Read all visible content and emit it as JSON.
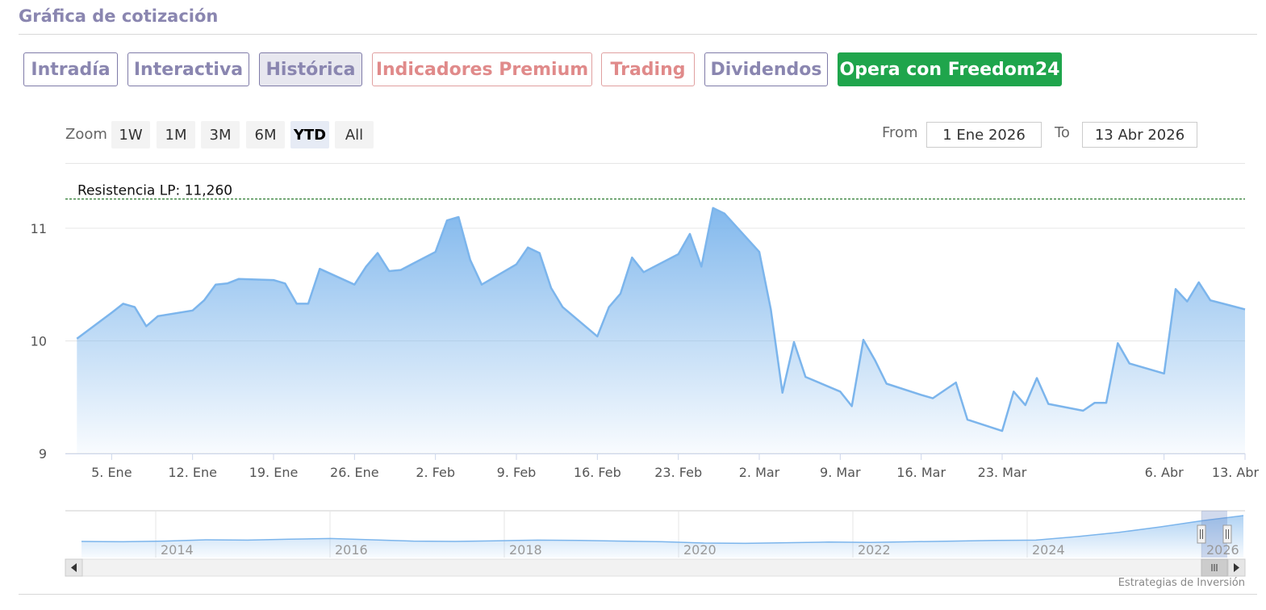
{
  "header": {
    "title": "Gráfica de cotización"
  },
  "tabs": [
    {
      "label": "Intradía",
      "style": "normal"
    },
    {
      "label": "Interactiva",
      "style": "normal"
    },
    {
      "label": "Histórica",
      "style": "active"
    },
    {
      "label": "Indicadores Premium",
      "style": "premium"
    },
    {
      "label": "Trading",
      "style": "premium"
    },
    {
      "label": "Dividendos",
      "style": "normal"
    },
    {
      "label": "Opera con Freedom24",
      "style": "cta"
    }
  ],
  "zoom": {
    "label": "Zoom",
    "buttons": [
      "1W",
      "1M",
      "3M",
      "6M",
      "YTD",
      "All"
    ],
    "selected": "YTD"
  },
  "range": {
    "from_label": "From",
    "from_value": "1 Ene 2026",
    "to_label": "To",
    "to_value": "13 Abr 2026"
  },
  "credit": "Estrategias de Inversión",
  "colors": {
    "line": "#7cb5ec",
    "area_top": "#7cb5ec",
    "resistance": "#2e7d32",
    "cta": "#1fa54c"
  },
  "chart_data": {
    "type": "area",
    "ylim": [
      9,
      11.15
    ],
    "yticks": [
      9,
      10,
      11
    ],
    "xlim": [
      "2026-01-01",
      "2026-04-13"
    ],
    "xticks": [
      {
        "date": "2026-01-05",
        "label": "5. Ene"
      },
      {
        "date": "2026-01-12",
        "label": "12. Ene"
      },
      {
        "date": "2026-01-19",
        "label": "19. Ene"
      },
      {
        "date": "2026-01-26",
        "label": "26. Ene"
      },
      {
        "date": "2026-02-02",
        "label": "2. Feb"
      },
      {
        "date": "2026-02-09",
        "label": "9. Feb"
      },
      {
        "date": "2026-02-16",
        "label": "16. Feb"
      },
      {
        "date": "2026-02-23",
        "label": "23. Feb"
      },
      {
        "date": "2026-03-02",
        "label": "2. Mar"
      },
      {
        "date": "2026-03-09",
        "label": "9. Mar"
      },
      {
        "date": "2026-03-16",
        "label": "16. Mar"
      },
      {
        "date": "2026-03-23",
        "label": "23. Mar"
      },
      {
        "date": "2026-04-06",
        "label": "6. Abr"
      },
      {
        "date": "2026-04-13",
        "label": "13. Abr"
      }
    ],
    "resistance": {
      "value": 11.26,
      "label": "Resistencia LP: 11,260"
    },
    "series": [
      {
        "x": [
          "2026-01-02",
          "2026-01-05",
          "2026-01-06",
          "2026-01-07",
          "2026-01-08",
          "2026-01-09",
          "2026-01-12",
          "2026-01-13",
          "2026-01-14",
          "2026-01-15",
          "2026-01-16",
          "2026-01-19",
          "2026-01-20",
          "2026-01-21",
          "2026-01-22",
          "2026-01-23",
          "2026-01-26",
          "2026-01-27",
          "2026-01-28",
          "2026-01-29",
          "2026-01-30",
          "2026-02-02",
          "2026-02-03",
          "2026-02-04",
          "2026-02-05",
          "2026-02-06",
          "2026-02-09",
          "2026-02-10",
          "2026-02-11",
          "2026-02-12",
          "2026-02-13",
          "2026-02-16",
          "2026-02-17",
          "2026-02-18",
          "2026-02-19",
          "2026-02-20",
          "2026-02-23",
          "2026-02-24",
          "2026-02-25",
          "2026-02-26",
          "2026-02-27",
          "2026-03-02",
          "2026-03-03",
          "2026-03-04",
          "2026-03-05",
          "2026-03-06",
          "2026-03-09",
          "2026-03-10",
          "2026-03-11",
          "2026-03-12",
          "2026-03-13",
          "2026-03-16",
          "2026-03-17",
          "2026-03-18",
          "2026-03-19",
          "2026-03-20",
          "2026-03-23",
          "2026-03-24",
          "2026-03-25",
          "2026-03-26",
          "2026-03-27",
          "2026-03-30",
          "2026-03-31",
          "2026-04-01",
          "2026-04-02",
          "2026-04-03",
          "2026-04-06",
          "2026-04-07",
          "2026-04-08",
          "2026-04-09",
          "2026-04-10",
          "2026-04-13"
        ],
        "values": [
          10.02,
          10.25,
          10.33,
          10.3,
          10.13,
          10.22,
          10.27,
          10.36,
          10.5,
          10.51,
          10.55,
          10.54,
          10.51,
          10.33,
          10.33,
          10.64,
          10.5,
          10.66,
          10.78,
          10.62,
          10.63,
          10.79,
          11.07,
          11.1,
          10.72,
          10.5,
          10.68,
          10.83,
          10.78,
          10.47,
          10.3,
          10.04,
          10.3,
          10.42,
          10.74,
          10.61,
          10.77,
          10.95,
          10.66,
          11.18,
          11.13,
          10.79,
          10.28,
          9.54,
          9.99,
          9.68,
          9.55,
          9.42,
          10.01,
          9.83,
          9.62,
          9.52,
          9.49,
          9.56,
          9.63,
          9.3,
          9.2,
          9.55,
          9.43,
          9.67,
          9.44,
          9.38,
          9.45,
          9.45,
          9.98,
          9.8,
          9.71,
          10.46,
          10.35,
          10.52,
          10.36,
          10.28
        ]
      }
    ],
    "navigator": {
      "labels": [
        "2014",
        "2016",
        "2018",
        "2020",
        "2022",
        "2024",
        "2026"
      ],
      "values": [
        2.0,
        1.9,
        2.1,
        2.5,
        2.4,
        2.7,
        2.9,
        2.5,
        2.1,
        2.0,
        2.2,
        2.4,
        2.3,
        2.1,
        1.9,
        1.5,
        1.4,
        1.6,
        1.8,
        1.7,
        1.9,
        2.1,
        2.3,
        2.4,
        3.5,
        4.8,
        6.5,
        8.4,
        10.0
      ]
    }
  }
}
